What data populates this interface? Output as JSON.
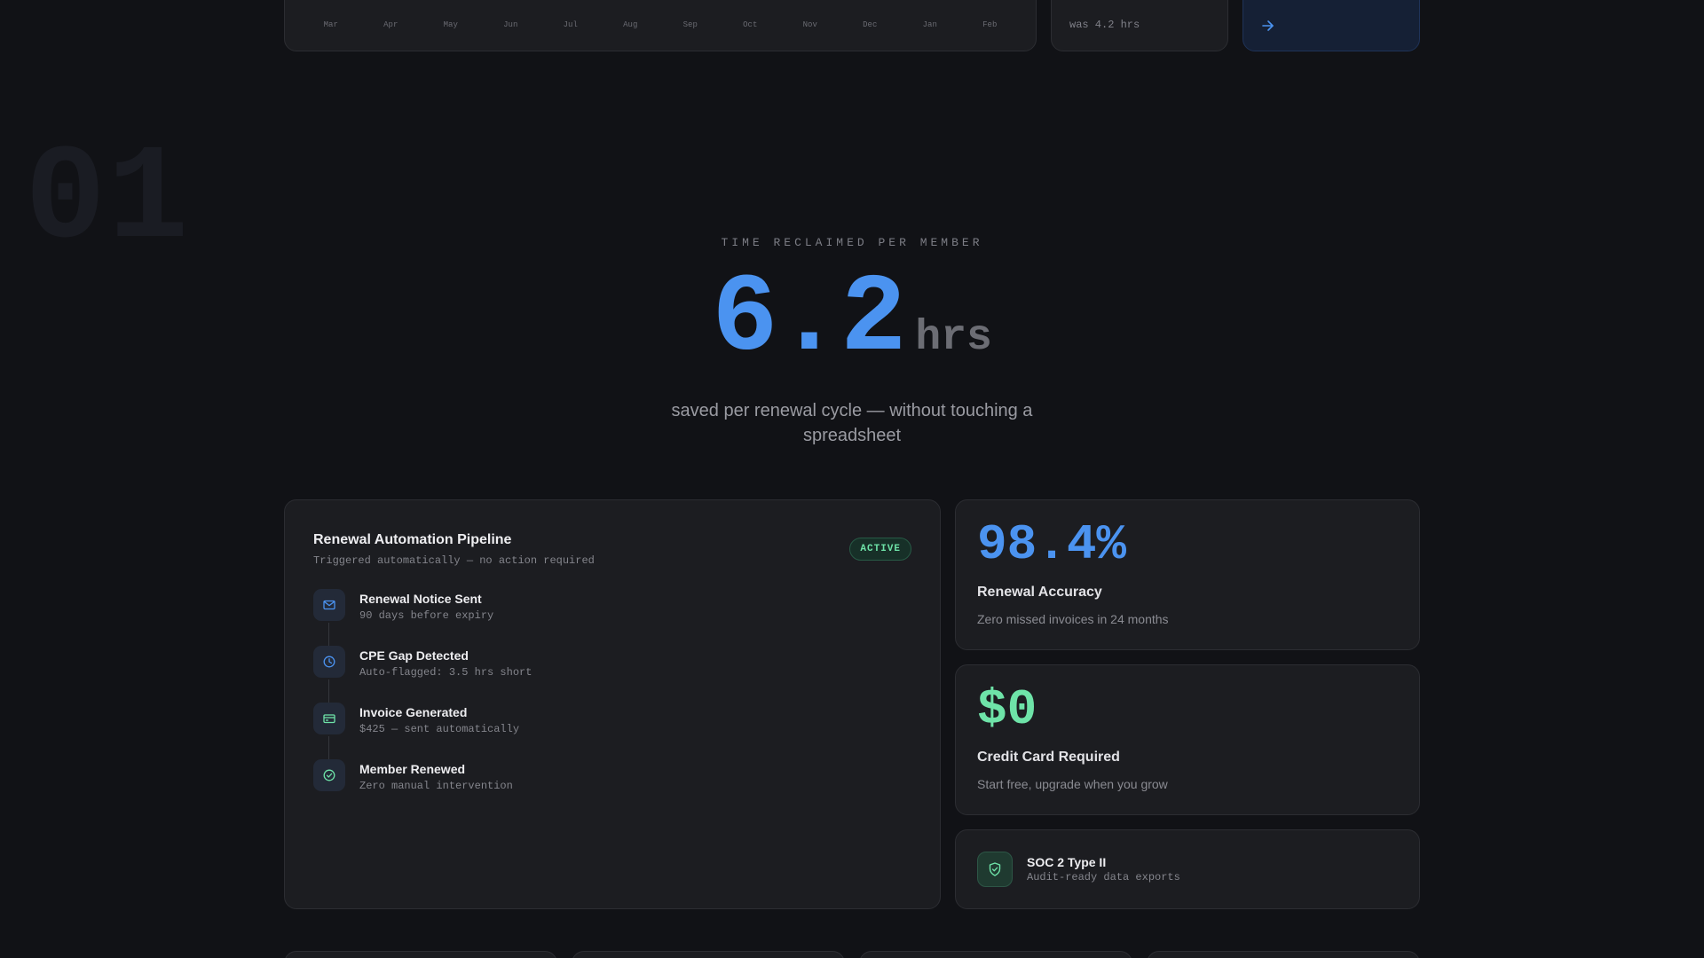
{
  "top_chart": {
    "months": [
      "Mar",
      "Apr",
      "May",
      "Jun",
      "Jul",
      "Aug",
      "Sep",
      "Oct",
      "Nov",
      "Dec",
      "Jan",
      "Feb"
    ]
  },
  "top_stat": {
    "was_text": "was 4.2 hrs"
  },
  "top_cta": {
    "icon": "arrow-right-icon",
    "accent": "#4b93f0"
  },
  "section": {
    "number": "01"
  },
  "hero": {
    "eyebrow": "TIME RECLAIMED PER MEMBER",
    "value": "6.2",
    "unit": "hrs",
    "subtitle": "saved per renewal cycle — without touching a spreadsheet",
    "value_color": "#4b93f0"
  },
  "pipeline": {
    "title": "Renewal Automation Pipeline",
    "subtitle": "Triggered automatically — no action required",
    "badge": "ACTIVE",
    "steps": [
      {
        "icon": "mail-icon",
        "title": "Renewal Notice Sent",
        "sub": "90 days before expiry"
      },
      {
        "icon": "clock-icon",
        "title": "CPE Gap Detected",
        "sub": "Auto-flagged: 3.5 hrs short"
      },
      {
        "icon": "credit-card-icon",
        "title": "Invoice Generated",
        "sub": "$425 — sent automatically"
      },
      {
        "icon": "check-circle-icon",
        "title": "Member Renewed",
        "sub": "Zero manual intervention"
      }
    ]
  },
  "metrics": [
    {
      "value": "98.4%",
      "label": "Renewal Accuracy",
      "desc": "Zero missed invoices in 24 months",
      "color": "#4b93f0"
    },
    {
      "value": "$0",
      "label": "Credit Card Required",
      "desc": "Start free, upgrade when you grow",
      "color": "#6ee3a8"
    }
  ],
  "soc": {
    "icon": "shield-check-icon",
    "title": "SOC 2 Type II",
    "sub": "Audit-ready data exports"
  }
}
